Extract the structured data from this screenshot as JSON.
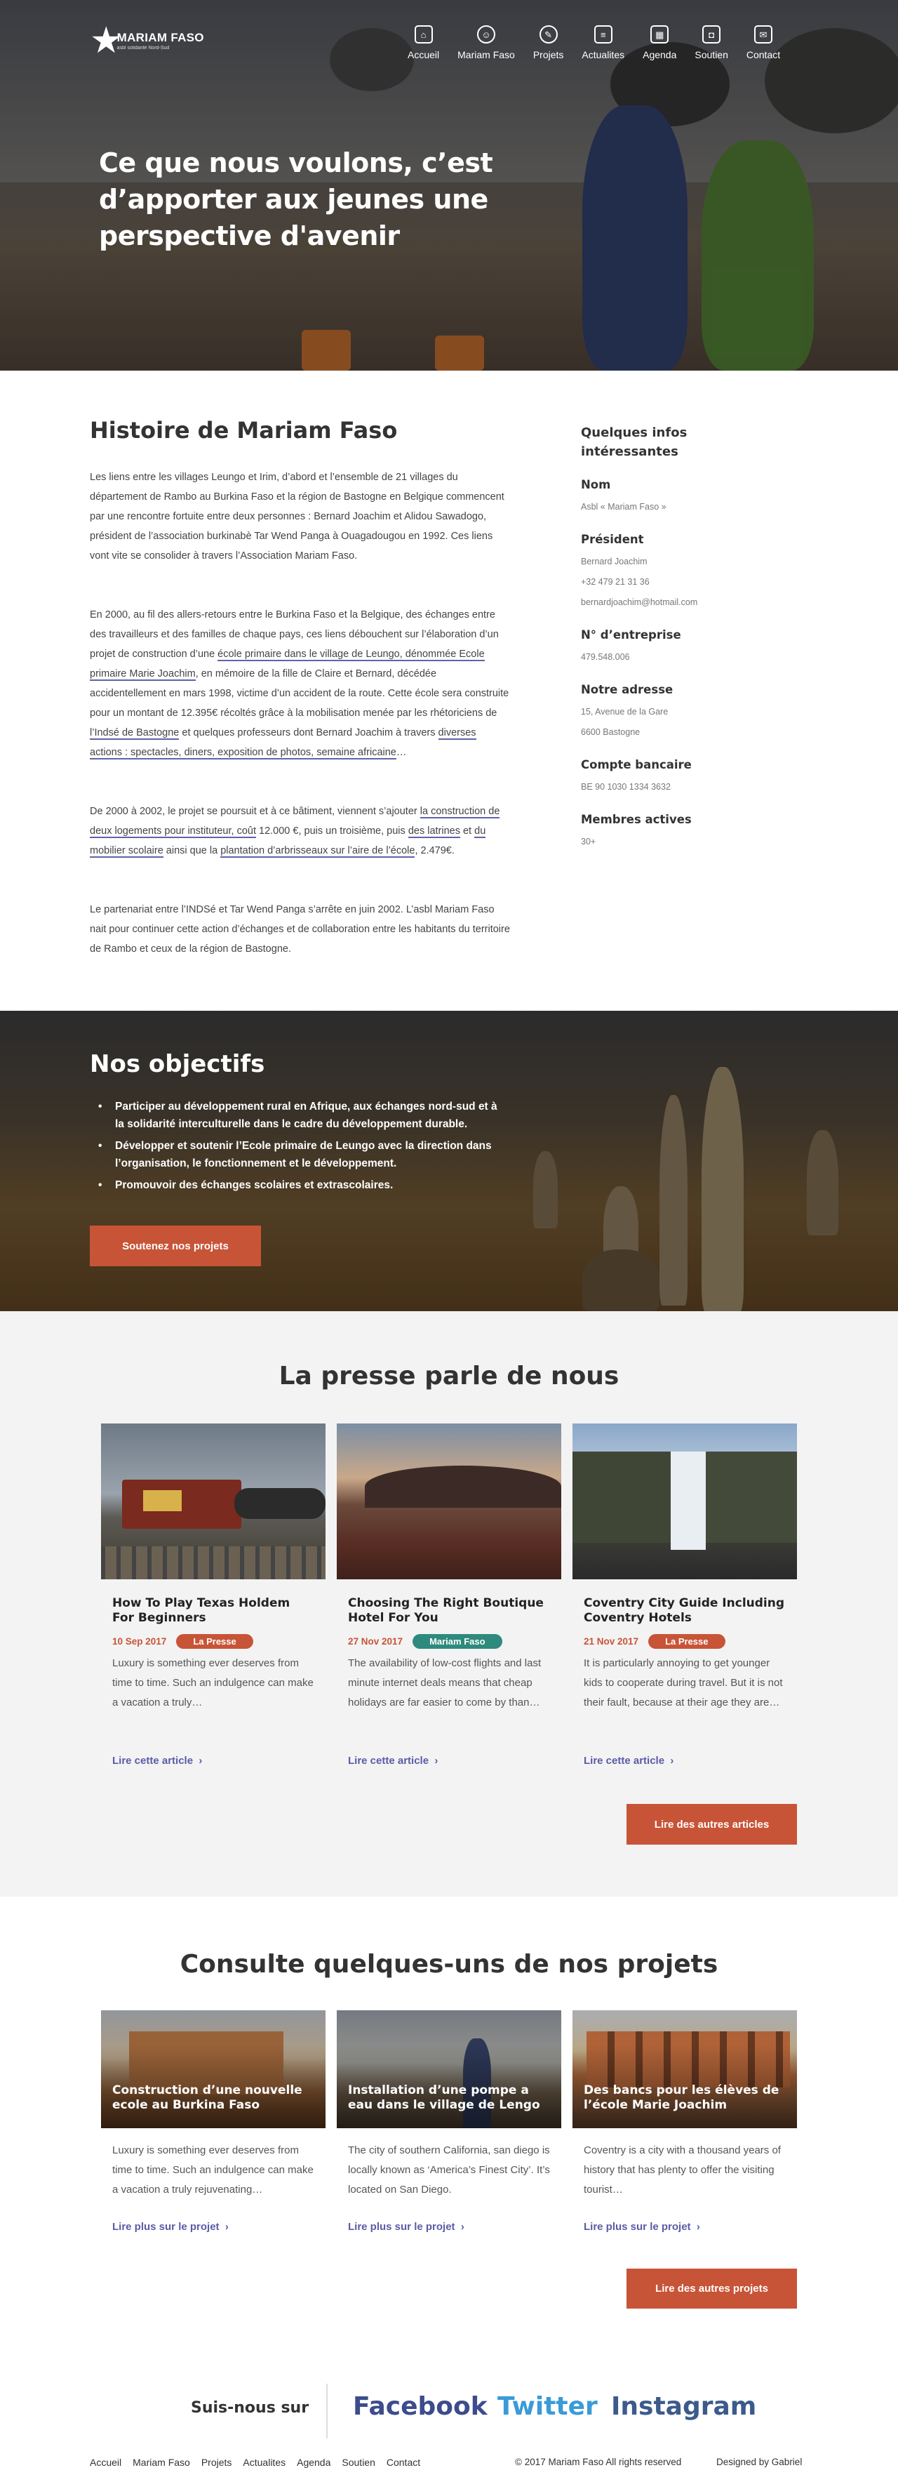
{
  "header": {
    "logo_name": "MARIAM FASO",
    "logo_sub": "asbl solidarité Nord-Sud",
    "nav": [
      {
        "label": "Accueil",
        "icon": "home-icon"
      },
      {
        "label": "Mariam Faso",
        "icon": "smile-icon"
      },
      {
        "label": "Projets",
        "icon": "pencil-icon"
      },
      {
        "label": "Actualites",
        "icon": "document-icon"
      },
      {
        "label": "Agenda",
        "icon": "calendar-icon"
      },
      {
        "label": "Soutien",
        "icon": "bag-icon"
      },
      {
        "label": "Contact",
        "icon": "mail-icon"
      }
    ]
  },
  "hero": {
    "title": "Ce que nous voulons, c’est d’apporter aux jeunes une perspective d'avenir"
  },
  "history": {
    "title": "Histoire de Mariam Faso",
    "p1": "Les liens  entre les villages Leungo et Irim, d’abord et l’ensemble de 21 villages du département de Rambo au Burkina Faso et la région de Bastogne en Belgique commencent par une rencontre fortuite entre deux personnes : Bernard Joachim et Alidou Sawadogo, président de l’association burkinabè Tar Wend Panga à Ouagadougou en 1992. Ces liens vont vite se consolider à travers l’Association Mariam Faso.",
    "p2_a": "En 2000, au fil des allers-retours entre le Burkina Faso et la Belgique, des échanges entre des travailleurs et des familles de chaque pays, ces liens débouchent sur l’élaboration d’un projet de construction d’une ",
    "p2_link1": "école primaire dans le village de Leungo, dénommée Ecole  primaire Marie Joachim",
    "p2_b": ", en mémoire de la fille de Claire et Bernard, décédée accidentellement en mars 1998, victime d’un accident de la route.  Cette école sera construite pour un montant de 12.395€ récoltés grâce à la mobilisation menée par les rhétoriciens de ",
    "p2_link2": "l’Indsé de Bastogne",
    "p2_c": " et quelques professeurs dont Bernard Joachim à travers ",
    "p2_link3": "diverses actions : spectacles, diners, exposition de photos, semaine africaine",
    "p2_d": "…",
    "p3_a": "De 2000 à 2002, le projet se poursuit et à ce bâtiment, viennent s’ajouter ",
    "p3_link1": "la construction de deux logements pour instituteur, coût",
    "p3_b": "  12.000 €, puis un troisième, puis ",
    "p3_link2": "des latrines",
    "p3_c": " et ",
    "p3_link3": "du mobilier scolaire",
    "p3_d": " ainsi que la ",
    "p3_link4": "plantation d’arbrisseaux  sur l’aire de l’école",
    "p3_e": ", 2.479€.",
    "p4": "Le partenariat entre l’INDSé  et Tar Wend Panga s’arrête en juin 2002. L’asbl Mariam Faso nait pour continuer cette action d’échanges et de collaboration entre les habitants du territoire de Rambo et ceux de la région de Bastogne."
  },
  "infos": {
    "title": "Quelques infos intéressantes",
    "blocks": [
      {
        "label": "Nom",
        "values": [
          "Asbl « Mariam Faso »"
        ]
      },
      {
        "label": "Président",
        "values": [
          "Bernard Joachim",
          "+32 479 21 31 36",
          "bernardjoachim@hotmail.com"
        ]
      },
      {
        "label": "N° d’entreprise",
        "values": [
          "479.548.006"
        ]
      },
      {
        "label": "Notre adresse",
        "values": [
          "15, Avenue de la Gare",
          "6600 Bastogne"
        ]
      },
      {
        "label": "Compte bancaire",
        "values": [
          "BE 90 1030 1334 3632"
        ]
      },
      {
        "label": "Membres actives",
        "values": [
          "30+"
        ]
      }
    ]
  },
  "objectives": {
    "title": "Nos objectifs",
    "items": [
      "Participer au développement rural en Afrique, aux échanges nord-sud et à la solidarité interculturelle dans le cadre du développement durable.",
      "Développer et soutenir l’Ecole primaire de Leungo avec la direction dans l’organisation, le fonctionnement et le développement.",
      "Promouvoir des échanges scolaires et extrascolaires."
    ],
    "button": "Soutenez nos projets"
  },
  "press": {
    "title": "La presse parle de nous",
    "cards": [
      {
        "title": "How To Play Texas Holdem For Beginners",
        "date": "10 Sep 2017",
        "tag": "La Presse",
        "tag_color": "#c85437",
        "desc": "Luxury is something ever  deserves from time to time. Such an indulgence can make a vacation a truly…",
        "link": "Lire cette article"
      },
      {
        "title": "Choosing The Right Boutique Hotel For You",
        "date": "27 Nov 2017",
        "tag": "Mariam Faso",
        "tag_color": "#2e8a7d",
        "desc": "The availability of low-cost flights and last minute internet deals means that cheap holidays are far easier to come by than…",
        "link": "Lire cette article"
      },
      {
        "title": "Coventry City Guide Including Coventry Hotels",
        "date": "21 Nov 2017",
        "tag": "La Presse",
        "tag_color": "#c85437",
        "desc": "It is particularly annoying to get younger kids to cooperate during travel. But it is not their fault, because at their age they are…",
        "link": "Lire cette article"
      }
    ],
    "more": "Lire des autres articles",
    "chevron": "›"
  },
  "projects": {
    "title": "Consulte quelques-uns de nos projets",
    "cards": [
      {
        "title": "Construction d’une nouvelle ecole au Burkina Faso",
        "desc": "Luxury is something ever  deserves from time to time. Such an indulgence can make a vacation a truly rejuvenating…",
        "link": "Lire plus sur le projet"
      },
      {
        "title": "Installation d’une pompe a eau dans  le village de Lengo",
        "desc": "The city of southern California, san diego is locally known as ‘America’s Finest City’. It’s located on San Diego.",
        "link": "Lire plus sur le projet"
      },
      {
        "title": "Des bancs pour les élèves de l’école Marie Joachim",
        "desc": "Coventry is a city with a thousand years of history that has plenty to offer the visiting tourist…",
        "link": "Lire plus sur le projet"
      }
    ],
    "more": "Lire des autres projets"
  },
  "social": {
    "label": "Suis-nous sur",
    "links": [
      {
        "label": "Facebook",
        "color": "#3c4c8c"
      },
      {
        "label": "Twitter",
        "color": "#3a9bd6"
      },
      {
        "label": "Instagram",
        "color": "#3c5a8c"
      }
    ]
  },
  "footer": {
    "nav": [
      "Accueil",
      "Mariam Faso",
      "Projets",
      "Actualites",
      "Agenda",
      "Soutien",
      "Contact"
    ],
    "copyright": "© 2017 Mariam Faso All rights reserved",
    "designed": "Designed by Gabriel"
  }
}
